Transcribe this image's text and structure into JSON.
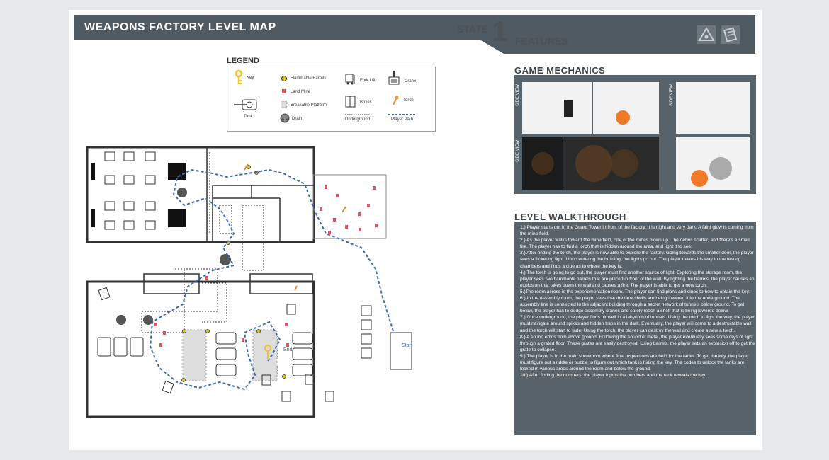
{
  "header": {
    "title": "WEAPONS FACTORY  LEVEL  MAP",
    "state_label": "STATE",
    "state_number": "1",
    "features_label": "FEATURES"
  },
  "legend": {
    "title": "LEGEND",
    "items": {
      "key": "Key",
      "flammable_barrels": "Flammable Barrels",
      "fork_lift": "Fork Lift",
      "crane": "Crane",
      "land_mine": "Land Mine",
      "torch": "Torch",
      "tank": "Tank",
      "breakable_platform": "Breakable Platform",
      "boxes": "Boxes",
      "drain": "Drain",
      "underground": "Underground",
      "player_path": "Player Path"
    }
  },
  "map": {
    "start_label": "Start",
    "end_label": "End"
  },
  "game_mechanics": {
    "title": "GAME  MECHANICS",
    "side_view_label": "SIDE VIEW"
  },
  "walkthrough": {
    "title": "LEVEL  WALKTHROUGH",
    "steps": [
      "1.) Player starts out in the Guard Tower in front of the factory. It is night and very dark. A faint glow is coming from the mine field.",
      "2.) As the player walks toward the mine field, one of the mines blows up. The debris scatter, and there's a small fire. The player has to find a torch that is hidden around the area, and light it to see.",
      "3.) After finding the torch, the player is now able to explore the factory. Going towards the smaller door, the player sees a flickering light. Upon entering the building, the lights go out. The player makes his way to the testing chambers and finds  a clue as to where the key is.",
      "4.) The torch is going to go out, the player must find another source of light. Exploring the storage room, the player sees two flammable barrels that are placed in front of the wall. By lighting the barrels, the player causes an explosion that takes down the wall and causes a fire. The player is able to get a new torch.",
      "5.)The room across is the experiementation room. The player can find plans and clues to how to obtain the key.",
      "6.) In the Assembly room, the player sees that the tank shells are being lowered into the underground. The assembly line is connected to the adjacent building through a secret network of tunnels below ground. To get below, the player has to dodge assembly cranes and safely reach a shell that is being lowered below.",
      "7.) Once underground, the player finds himself in a labyrinth of tunnels. Using the torch to light the way, the player must navigate around spikes and hidden traps in the dark. Eventually, the player will come to a destructable wall and the torch will start to fade. Using the torch, the player can destroy the wall and create a new a torch.",
      "8.) A sound emits from above ground. Following the sound of metal, the player eventually sees some rays of light through a grated floor. These grates are easily destroyed. Using barrels, the player sets an explosion off to get the grate to collapse.",
      "9.) The player is in the main showroom where final inspections are held for the tanks. To get the key, the player must figure out a riddle or puzzle to figure out which tank is hiding the key. The codes to unlock the tanks are locked in various areas around the room and below the ground.",
      "10.) After finding the numbers, the player inputs the numbers and the tank reveals the key."
    ]
  },
  "colors": {
    "header_bg": "#4f5a62",
    "panel_bg": "#59636b",
    "path": "#3a68b8",
    "mine": "#d9575e",
    "barrel": "#d8c01e",
    "key": "#f0c22a"
  }
}
